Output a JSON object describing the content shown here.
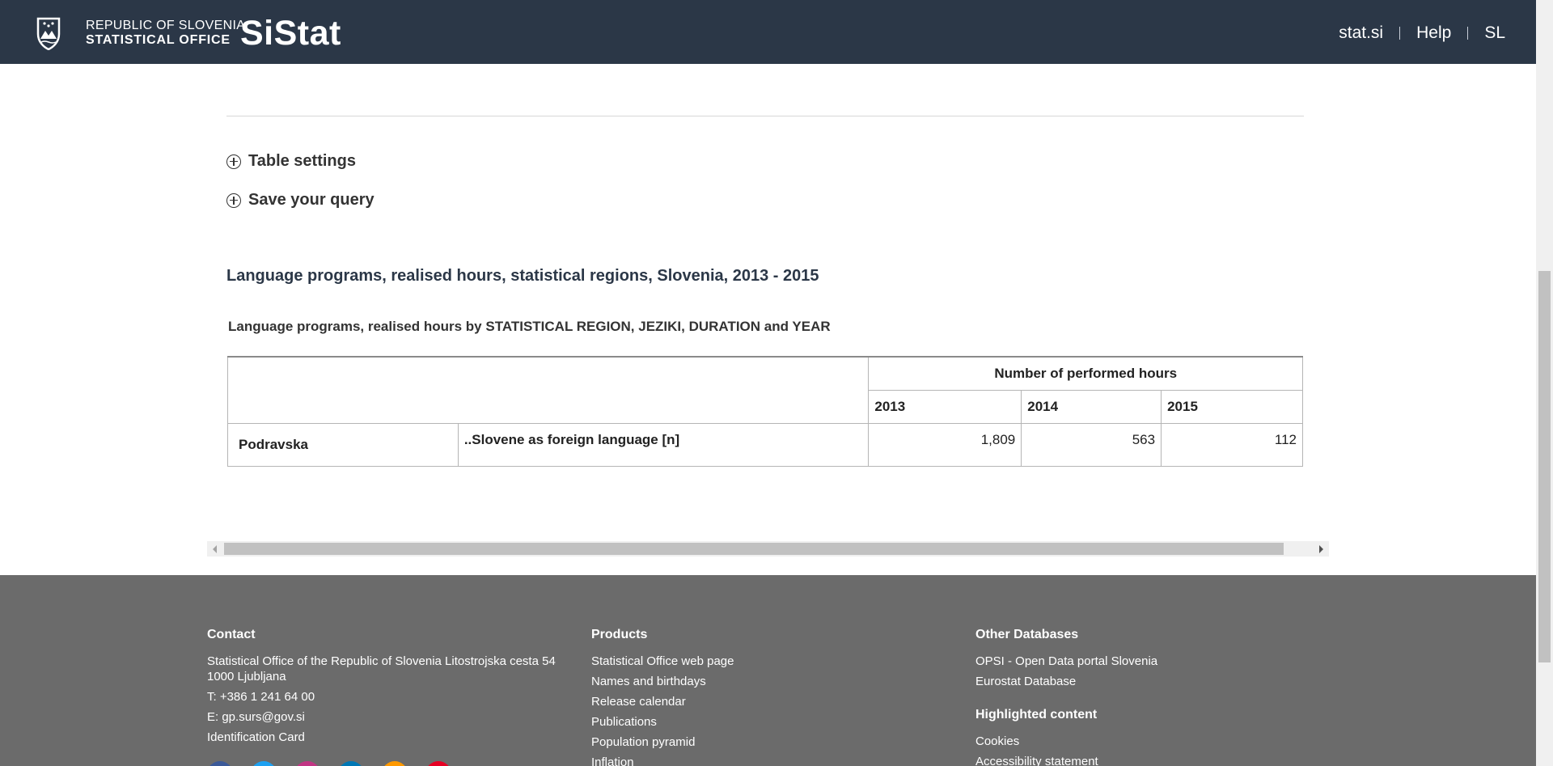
{
  "header": {
    "logo_line1": "REPUBLIC OF SLOVENIA",
    "logo_line2": "STATISTICAL OFFICE",
    "brand": "SiStat",
    "nav": [
      "stat.si",
      "Help",
      "SL"
    ]
  },
  "expanders": {
    "table_settings": "Table settings",
    "save_query": "Save your query"
  },
  "table": {
    "title": "Language programs, realised hours, statistical regions, Slovenia, 2013 - 2015",
    "caption": "Language programs, realised hours by STATISTICAL REGION, JEZIKI, DURATION and YEAR",
    "group_header": "Number of performed hours",
    "years": [
      "2013",
      "2014",
      "2015"
    ],
    "rows": [
      {
        "region": "Podravska",
        "language": "..Slovene as foreign language [n]",
        "values": [
          "1,809",
          "563",
          "112"
        ]
      }
    ]
  },
  "footer": {
    "contact": {
      "heading": "Contact",
      "address": "Statistical Office of the Republic of Slovenia Litostrojska cesta 54 1000 Ljubljana",
      "phone": "T: +386 1 241 64 00",
      "email": "E: gp.surs@gov.si",
      "id_card": "Identification Card"
    },
    "products": {
      "heading": "Products",
      "items": [
        "Statistical Office web page",
        "Names and birthdays",
        "Release calendar",
        "Publications",
        "Population pyramid",
        "Inflation"
      ]
    },
    "other_databases": {
      "heading": "Other Databases",
      "items": [
        "OPSI - Open Data portal Slovenia",
        "Eurostat Database"
      ]
    },
    "highlighted": {
      "heading": "Highlighted content",
      "items": [
        "Cookies",
        "Accessibility statement"
      ]
    },
    "social_colors": [
      "#3b5998",
      "#1da1f2",
      "#c13584",
      "#0077b5",
      "#ff9900",
      "#e60023"
    ]
  },
  "colors": {
    "header_bg": "#2b3747",
    "footer_bg": "#6b6b6b"
  }
}
